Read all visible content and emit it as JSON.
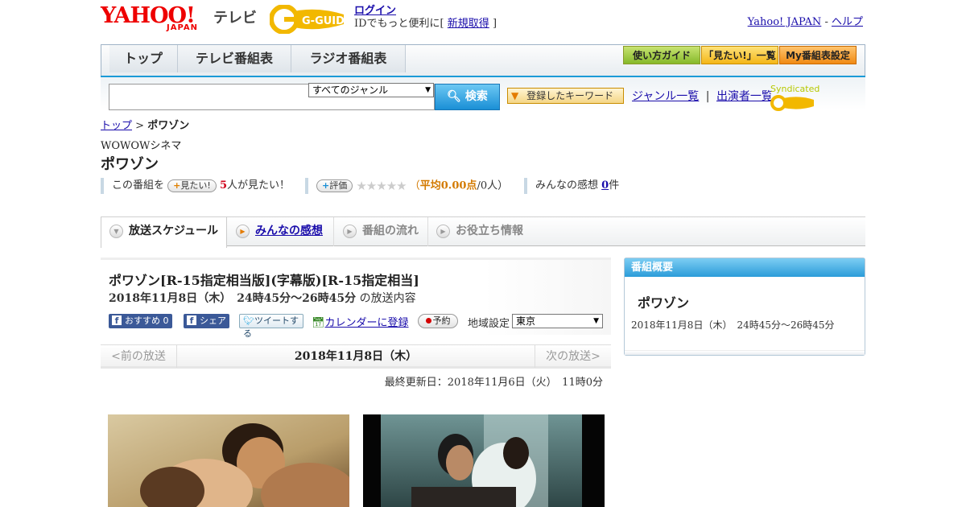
{
  "header": {
    "logo_text": "YAHOO!",
    "logo_sub": "JAPAN",
    "service_name": "テレビ",
    "partner_logo": "G-GUIDE",
    "login_link": "ログイン",
    "login_message_prefix": "IDでもっと便利に[",
    "signup_link": "新規取得",
    "login_message_suffix": "]",
    "yahoo_japan_link": "Yahoo! JAPAN",
    "link_separator": "-",
    "help_link": "ヘルプ"
  },
  "global_nav": {
    "tabs": [
      {
        "label": "トップ"
      },
      {
        "label": "テレビ番組表"
      },
      {
        "label": "ラジオ番組表"
      }
    ],
    "utility_buttons": [
      {
        "label": "使い方ガイド"
      },
      {
        "label": "「見たい!」一覧"
      },
      {
        "label": "My番組表設定"
      }
    ]
  },
  "search": {
    "input_value": "",
    "genre_selected": "すべてのジャンル",
    "search_button": "検索",
    "keyword_button": "登録したキーワード",
    "genre_list_link": "ジャンル一覧",
    "separator": "|",
    "cast_list_link": "出演者一覧",
    "syndicated_label": "Syndicated"
  },
  "breadcrumb": {
    "top_link": "トップ",
    "separator": ">",
    "current": "ポワゾン"
  },
  "program": {
    "channel": "WOWOWシネマ",
    "title": "ポワゾン"
  },
  "stats": {
    "want_prefix": "この番組を",
    "want_button": "見たい!",
    "want_count": "5",
    "want_suffix": "人が見たい！",
    "rate_button": "評価",
    "stars": "★★★★★",
    "rating_open": "（",
    "rating_label": "平均0.00点",
    "rating_people": "/0人）",
    "reviews_label": "みんなの感想",
    "reviews_count": "0",
    "reviews_unit": "件"
  },
  "tabs": [
    {
      "label": "放送スケジュール",
      "active": true
    },
    {
      "label": "みんなの感想",
      "active": false
    },
    {
      "label": "番組の流れ",
      "active": false
    },
    {
      "label": "お役立ち情報",
      "active": false
    }
  ],
  "broadcast": {
    "title": "ポワゾン[R-15指定相当版](字幕版)[R-15指定相当]",
    "datetime": "2018年11月8日（木）　24時45分～26時45分",
    "datetime_suffix": "の放送内容",
    "recommend_button": "おすすめ",
    "recommend_count": "0",
    "share_button": "シェア",
    "tweet_button": "ツイートする",
    "calendar_link": "カレンダーに登録",
    "reserve_button": "予約",
    "region_label": "地域設定",
    "region_selected": "東京"
  },
  "day_nav": {
    "prev": "<前の放送",
    "current": "2018年11月8日（木）",
    "next": "次の放送>"
  },
  "last_updated": "最終更新日：2018年11月6日（火）　11時0分",
  "sidebar": {
    "heading": "番組概要",
    "program_title": "ポワゾン",
    "time": "2018年11月8日（木）　24時45分～26時45分"
  },
  "colors": {
    "accent_blue": "#1a9bd7",
    "yahoo_red": "#ee0000",
    "link": "#1a0dab",
    "orange": "#d37a00"
  }
}
